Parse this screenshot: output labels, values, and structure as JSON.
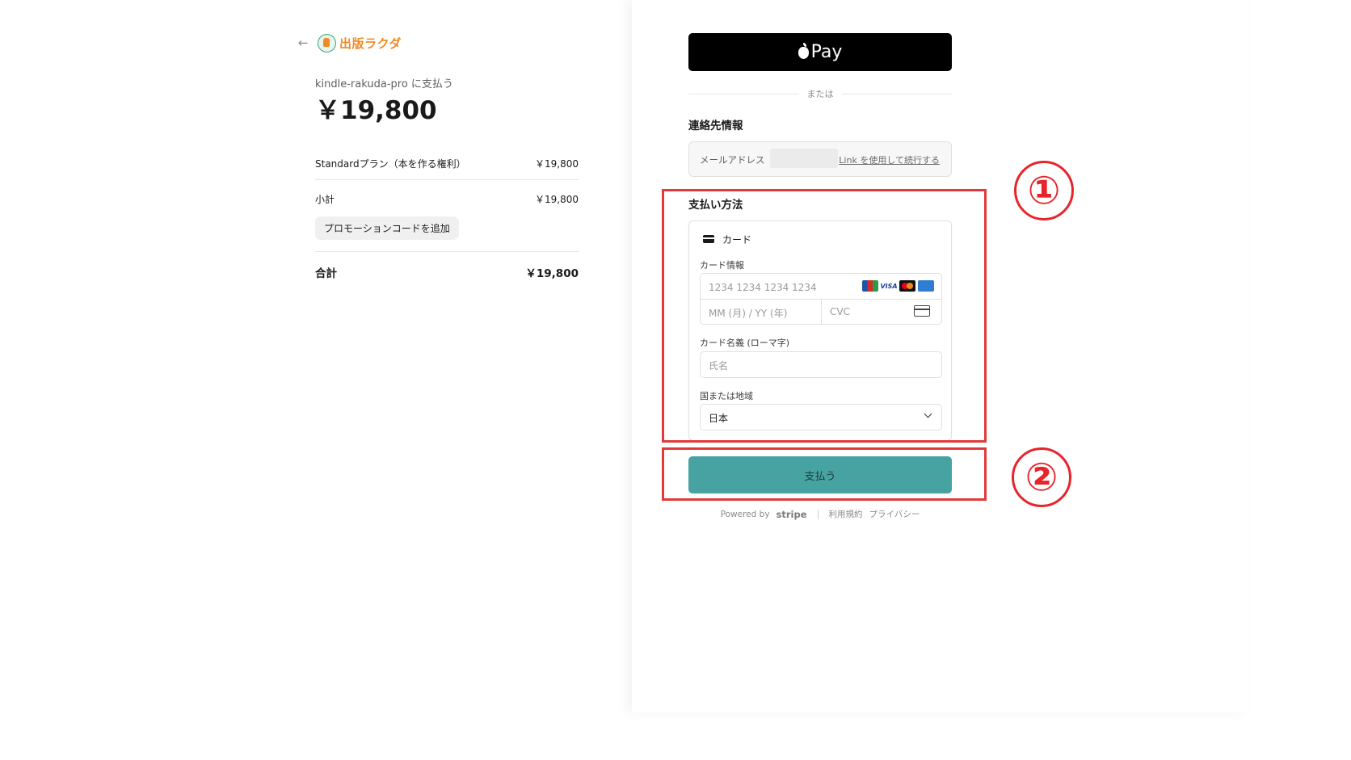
{
  "merchant": {
    "logo_text": "出版ラクダ",
    "pay_to": "kindle-rakuda-pro に支払う",
    "amount": "￥19,800"
  },
  "summary": {
    "items": [
      {
        "label": "Standardプラン（本を作る権利）",
        "price": "￥19,800"
      }
    ],
    "subtotal_label": "小計",
    "subtotal_value": "￥19,800",
    "promo_button": "プロモーションコードを追加",
    "total_label": "合計",
    "total_value": "￥19,800"
  },
  "checkout": {
    "applepay_label": "Pay",
    "or_text": "または",
    "contact_title": "連絡先情報",
    "email_label": "メールアドレス",
    "link_continue": "Link を使用して続行する",
    "payment_method_title": "支払い方法",
    "card_tab_label": "カード",
    "card_info_label": "カード情報",
    "card_number_placeholder": "1234 1234 1234 1234",
    "expiry_placeholder": "MM (月) / YY (年)",
    "cvc_placeholder": "CVC",
    "card_brands": [
      "JCB",
      "VISA",
      "Mastercard",
      "American Express"
    ],
    "cardholder_label": "カード名義 (ローマ字)",
    "cardholder_placeholder": "氏名",
    "country_label": "国または地域",
    "country_value": "日本",
    "pay_button": "支払う"
  },
  "footer": {
    "powered_by": "Powered by",
    "stripe": "stripe",
    "terms": "利用規約",
    "privacy": "プライバシー"
  },
  "annotations": {
    "marker_1": "①",
    "marker_2": "②",
    "color": "#e8242b"
  },
  "colors": {
    "pay_button": "#46a3a2",
    "applepay_bg": "#000000",
    "logo_orange": "#f08a24"
  }
}
